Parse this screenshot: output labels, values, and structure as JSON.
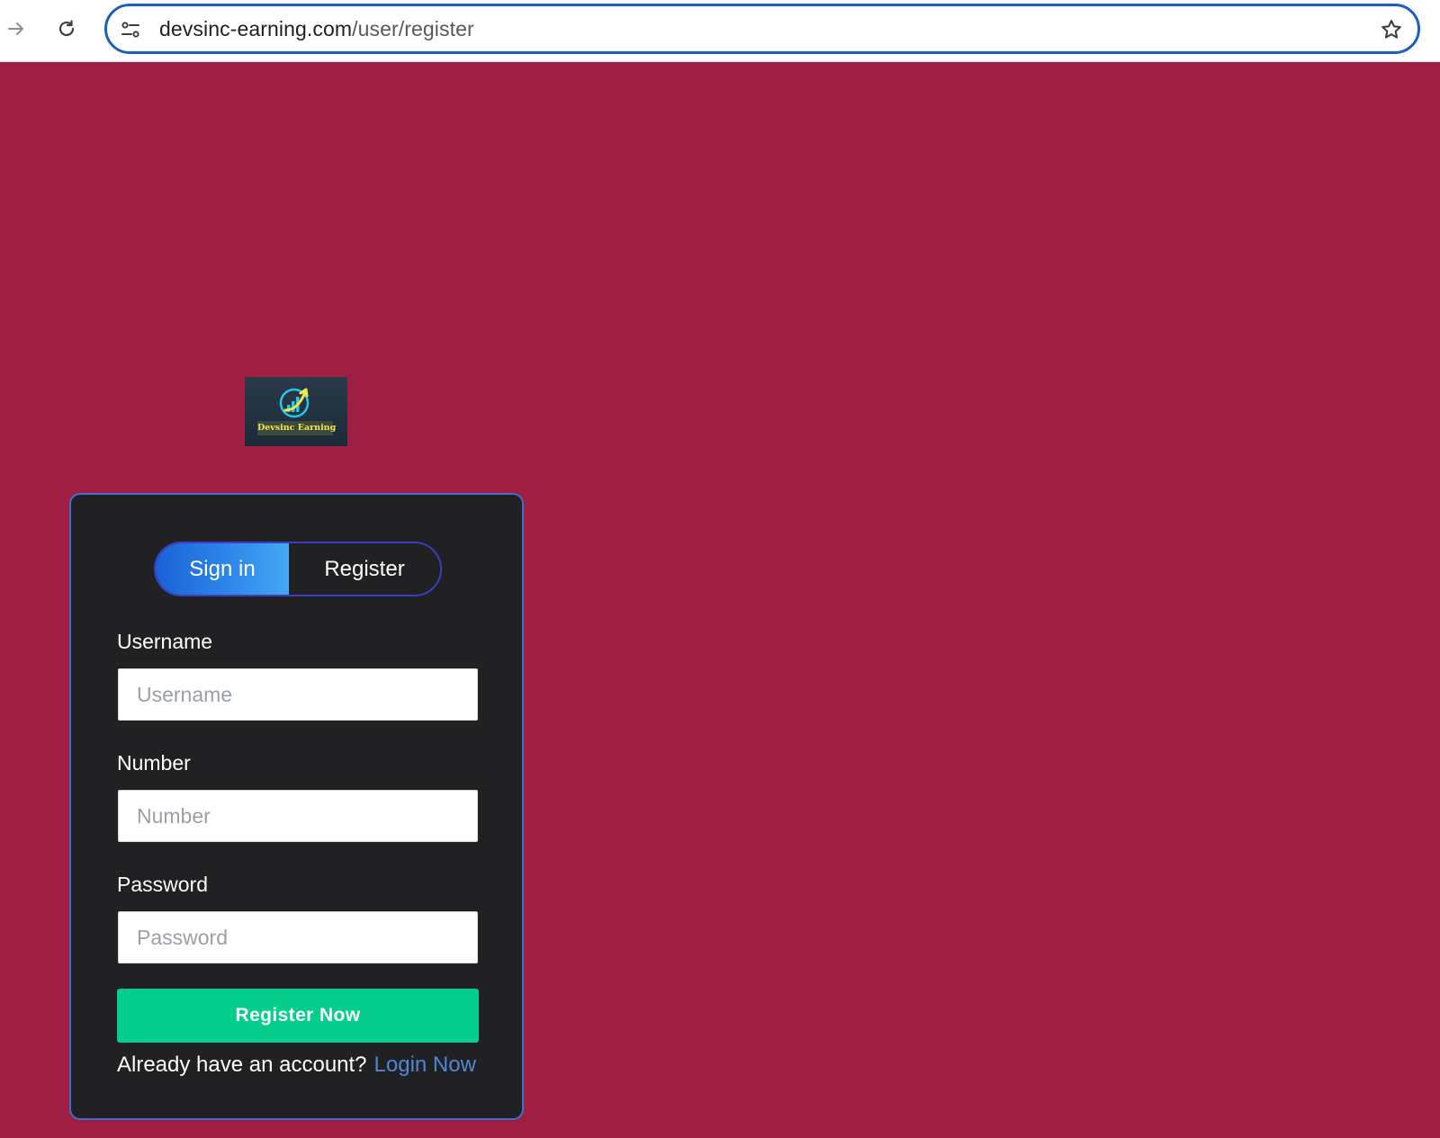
{
  "browser": {
    "url_host": "devsinc-earning.com",
    "url_path": "/user/register",
    "icons": {
      "forward": "arrow-right-icon",
      "reload": "reload-icon",
      "site_info": "tune-icon",
      "bookmark": "star-icon"
    }
  },
  "logo": {
    "text": "Devsinc Earning"
  },
  "tabs": {
    "signin_label": "Sign in",
    "register_label": "Register",
    "active": "signin"
  },
  "form": {
    "username": {
      "label": "Username",
      "placeholder": "Username",
      "value": ""
    },
    "number": {
      "label": "Number",
      "placeholder": "Number",
      "value": ""
    },
    "password": {
      "label": "Password",
      "placeholder": "Password",
      "value": ""
    },
    "submit_label": "Register Now",
    "footer_text": "Already have an account?",
    "login_link": "Login Now"
  },
  "colors": {
    "page_background": "#9e1f41",
    "card_background": "#212124",
    "card_border": "#3f6fd0",
    "submit_button": "#05cd8b",
    "active_tab": "#2f86ea",
    "link": "#4f86d8",
    "omnibox_border": "#1c5fbf"
  }
}
